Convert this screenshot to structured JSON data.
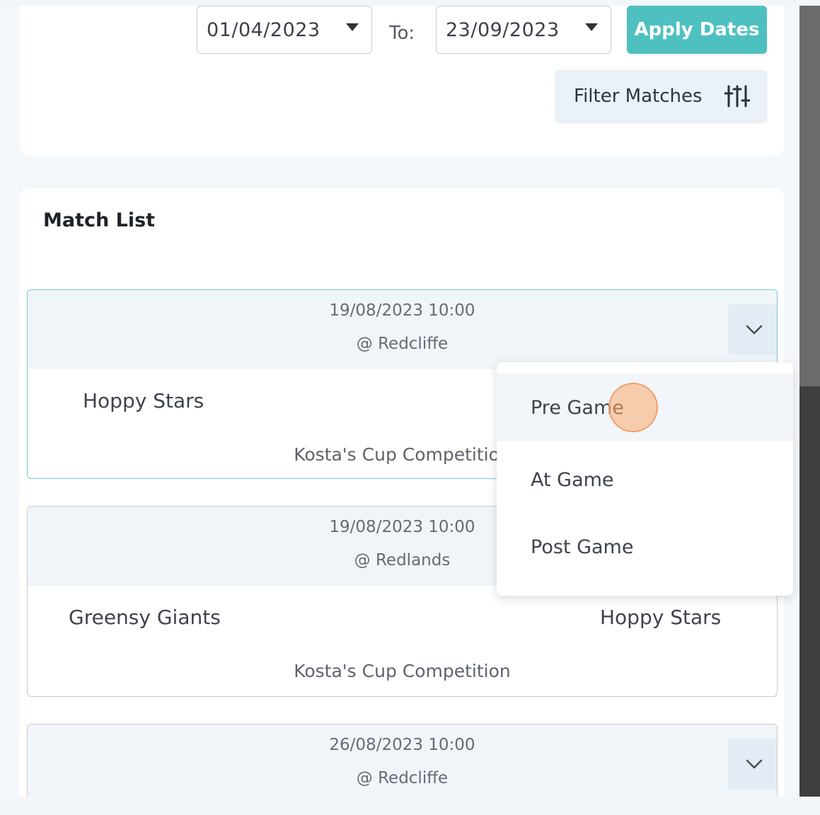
{
  "date_filter": {
    "from_value": "01/04/2023",
    "to_label": "To:",
    "to_value": "23/09/2023",
    "apply_label": "Apply Dates",
    "filter_label": "Filter Matches"
  },
  "match_list": {
    "title": "Match List",
    "matches": [
      {
        "datetime": "19/08/2023 10:00",
        "venue": "@ Redcliffe",
        "home_team": "Hoppy Stars",
        "away_team": "",
        "competition": "Kosta's Cup Competition"
      },
      {
        "datetime": "19/08/2023 10:00",
        "venue": "@ Redlands",
        "home_team": "Greensy Giants",
        "away_team": "Hoppy Stars",
        "competition": "Kosta's Cup Competition"
      },
      {
        "datetime": "26/08/2023 10:00",
        "venue": "@ Redcliffe",
        "home_team": "",
        "away_team": "",
        "competition": ""
      }
    ]
  },
  "dropdown": {
    "items": [
      "Pre Game",
      "At Game",
      "Post Game"
    ],
    "hovered": "Pre Game"
  },
  "colors": {
    "accent": "#4fc0c0",
    "filter_bg": "#eaf1f7",
    "header_bg": "#f0f5fa"
  }
}
